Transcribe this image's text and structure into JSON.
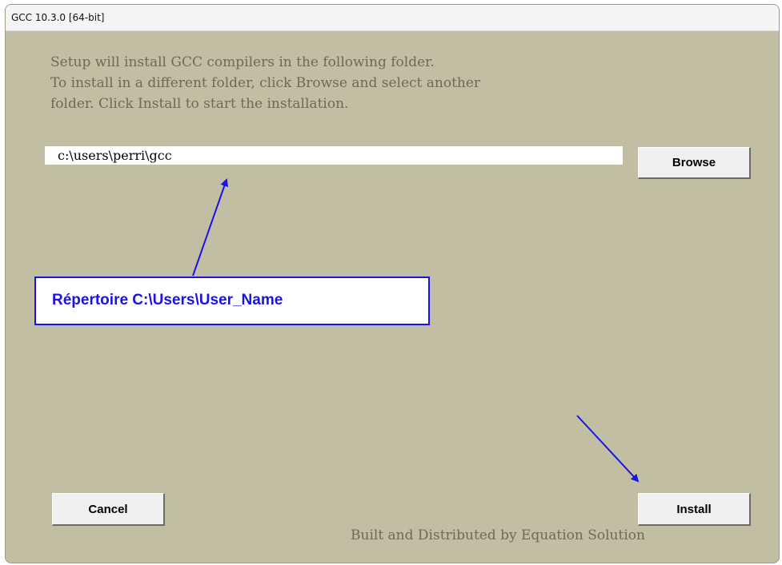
{
  "window": {
    "title": "GCC 10.3.0 [64-bit]"
  },
  "instructions": {
    "line1": "Setup will install GCC compilers in the following folder.",
    "line2": "To install in a different folder, click Browse and select another",
    "line3": "folder. Click Install to start the installation."
  },
  "install_path": {
    "value": "c:\\users\\perri\\gcc"
  },
  "buttons": {
    "browse": "Browse",
    "cancel": "Cancel",
    "install": "Install"
  },
  "footer": {
    "credit": "Built and Distributed by Equation Solution"
  },
  "annotation": {
    "label": "Répertoire C:\\Users\\User_Name",
    "color": "#1a12e6"
  },
  "colors": {
    "dialog_background": "#c2bea3",
    "text": "#6e6a59"
  }
}
